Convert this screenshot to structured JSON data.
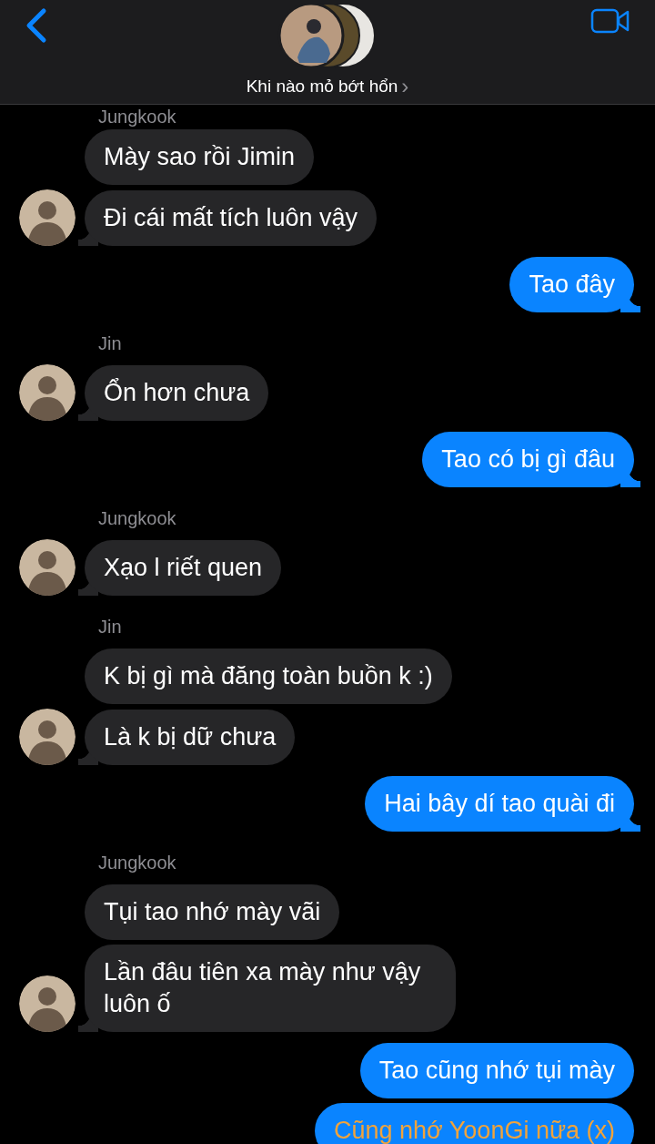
{
  "header": {
    "title": "Khi nào mỏ bớt hổn",
    "chevron": "›"
  },
  "messages": [
    {
      "kind": "sender",
      "text": "Jungkook"
    },
    {
      "kind": "in",
      "text": "Mày sao rồi Jimin",
      "avatar": false,
      "tail": false
    },
    {
      "kind": "in",
      "text": "Đi cái mất tích luôn vậy",
      "avatar": true,
      "tail": true
    },
    {
      "kind": "out",
      "text": "Tao đây",
      "tail": true
    },
    {
      "kind": "sender",
      "text": "Jin"
    },
    {
      "kind": "in",
      "text": "Ổn hơn chưa",
      "avatar": true,
      "tail": true
    },
    {
      "kind": "out",
      "text": "Tao có bị gì đâu",
      "tail": true
    },
    {
      "kind": "sender",
      "text": "Jungkook"
    },
    {
      "kind": "in",
      "text": "Xạo l riết quen",
      "avatar": true,
      "tail": true
    },
    {
      "kind": "sender",
      "text": "Jin"
    },
    {
      "kind": "in",
      "text": "K bị gì mà đăng toàn buồn k :)",
      "avatar": false,
      "tail": false
    },
    {
      "kind": "in",
      "text": "Là k bị dữ chưa",
      "avatar": true,
      "tail": true
    },
    {
      "kind": "out",
      "text": "Hai bây dí tao quài đi",
      "tail": true
    },
    {
      "kind": "sender",
      "text": "Jungkook"
    },
    {
      "kind": "in",
      "text": "Tụi tao nhớ mày vãi",
      "avatar": false,
      "tail": false
    },
    {
      "kind": "in",
      "text": "Lần đâu tiên xa mày như vậy luôn ố",
      "avatar": true,
      "tail": true
    },
    {
      "kind": "out",
      "text": "Tao cũng nhớ tụi mày",
      "tail": false
    },
    {
      "kind": "out",
      "text": "Cũng nhớ YoonGi nữa (x)",
      "tail": false,
      "color": "#f2a33a"
    }
  ]
}
